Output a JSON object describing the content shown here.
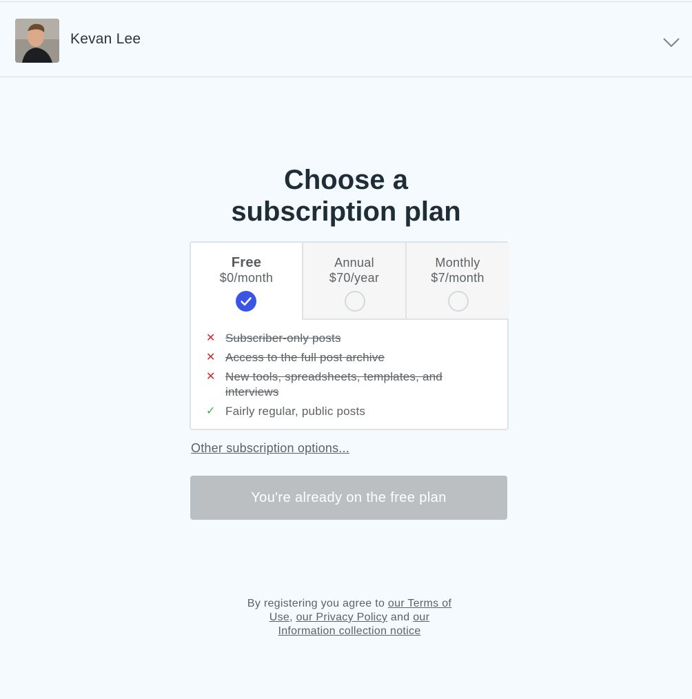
{
  "header": {
    "user_name": "Kevan Lee",
    "avatar_icon": "user-avatar",
    "menu_icon": "chevron-down-icon"
  },
  "main": {
    "title_line1": "Choose a",
    "title_line2": "subscription plan",
    "plans": [
      {
        "name": "Free",
        "price": "$0/month",
        "selected": true
      },
      {
        "name": "Annual",
        "price": "$70/year",
        "selected": false
      },
      {
        "name": "Monthly",
        "price": "$7/month",
        "selected": false
      }
    ],
    "features": [
      {
        "text": "Subscriber-only posts",
        "included": false
      },
      {
        "text": "Access to the full post archive",
        "included": false
      },
      {
        "text": "New tools, spreadsheets, templates, and interviews",
        "included": false
      },
      {
        "text": "Fairly regular, public posts",
        "included": true
      }
    ],
    "other_options_link": "Other subscription options...",
    "cta_label": "You're already on the free plan"
  },
  "legal": {
    "prefix": "By registering you agree to ",
    "terms_link": "our Terms of Use",
    "sep1": ", ",
    "privacy_link": "our Privacy Policy",
    "sep2": " and ",
    "notice_link": "our Information collection notice"
  },
  "colors": {
    "background": "#f4fafd",
    "accent": "#3a55e6",
    "cross": "#d9232e",
    "check": "#34b34a",
    "disabled_button": "#bcbfc1"
  }
}
